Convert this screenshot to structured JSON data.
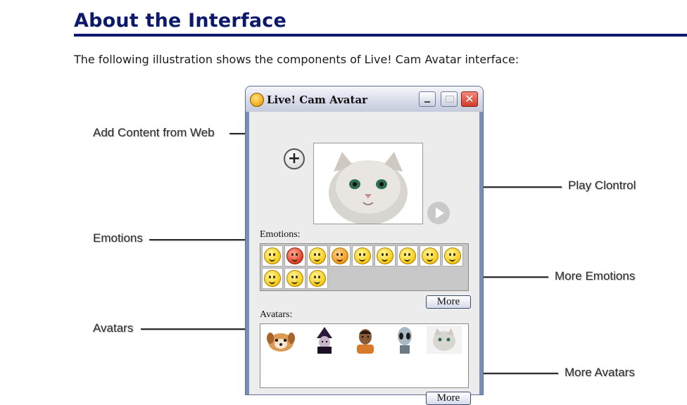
{
  "page": {
    "title": "About the Interface",
    "intro": "The following illustration shows the components of Live! Cam Avatar interface:"
  },
  "window": {
    "title": "Live! Cam Avatar",
    "close_glyph": "✕",
    "emotions_label": "Emotions:",
    "avatars_label": "Avatars:",
    "more_emotions_button": "More",
    "more_avatars_button": "More",
    "add_glyph": "+",
    "emotions": [
      {
        "icon": "sick-face-icon"
      },
      {
        "icon": "angry-face-icon"
      },
      {
        "icon": "smile-face-icon"
      },
      {
        "icon": "kiss-face-icon"
      },
      {
        "icon": "happy-face-icon"
      },
      {
        "icon": "thinking-face-icon"
      },
      {
        "icon": "sleepy-face-icon"
      },
      {
        "icon": "grin-face-icon"
      },
      {
        "icon": "laugh-face-icon"
      },
      {
        "icon": "surprised-face-icon"
      },
      {
        "icon": "crying-face-icon"
      },
      {
        "icon": "sad-face-icon"
      }
    ],
    "avatars": [
      {
        "icon": "puppy-avatar-icon"
      },
      {
        "icon": "witch-avatar-icon"
      },
      {
        "icon": "man-avatar-icon"
      },
      {
        "icon": "alien-avatar-icon"
      },
      {
        "icon": "kitten-avatar-icon"
      }
    ]
  },
  "callouts": {
    "add_content": "Add Content from Web",
    "play_control": "Play Clontrol",
    "emotions": "Emotions",
    "more_emotions": "More Emotions",
    "avatars": "Avatars",
    "more_avatars": "More Avatars"
  },
  "colors": {
    "heading": "#0d1a6b",
    "window_frame": "#7a8fb8",
    "close_button": "#cf3b2a"
  }
}
